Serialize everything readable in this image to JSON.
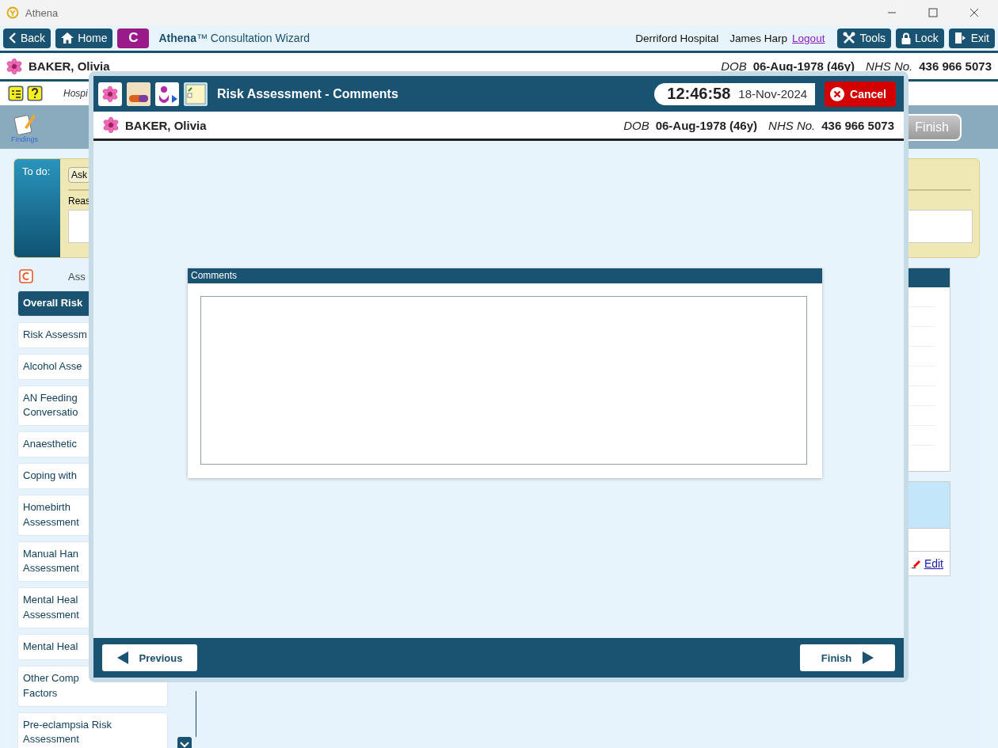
{
  "window": {
    "title": "Athena"
  },
  "nav": {
    "buttons": [
      {
        "label": "Back",
        "kind": "back"
      },
      {
        "label": "Home",
        "kind": "home"
      }
    ],
    "module_badge": "C",
    "app_title": "**Athena**™ Consultation Wizard",
    "location": "Derriford Hospital",
    "user": "James Harp",
    "logout": "Logout",
    "actions": [
      {
        "label": "Tools",
        "kind": "tools"
      },
      {
        "label": "Lock",
        "kind": "lock"
      },
      {
        "label": "Exit",
        "kind": "exit"
      }
    ]
  },
  "patient": {
    "name": "BAKER, Olivia",
    "dob_label": "DOB",
    "dob": "06-Aug-1978 (46y)",
    "nhs_label": "NHS No.",
    "nhs": "436 966 5073"
  },
  "toolbar": {
    "text": "Hospi"
  },
  "steps": {
    "findings_label": "Findings",
    "finish": {
      "label": "Finish",
      "disabled": true
    }
  },
  "todo": {
    "label": "To do:",
    "chip": "Ask",
    "reason_label": "Reas"
  },
  "assessments": {
    "heading": "Ass",
    "items": [
      {
        "lines": [
          "Overall Risk"
        ],
        "selected": true
      },
      {
        "lines": [
          "Risk Assessm"
        ],
        "selected": false
      },
      {
        "lines": [
          "Alcohol Asse"
        ],
        "selected": false
      },
      {
        "lines": [
          "AN Feeding",
          "Conversatio"
        ],
        "selected": false
      },
      {
        "lines": [
          "Anaesthetic"
        ],
        "selected": false
      },
      {
        "lines": [
          "Coping with"
        ],
        "selected": false
      },
      {
        "lines": [
          "Homebirth",
          "Assessment"
        ],
        "selected": false
      },
      {
        "lines": [
          "Manual Han",
          "Assessment"
        ],
        "selected": false
      },
      {
        "lines": [
          "Mental Heal",
          "Assessment"
        ],
        "selected": false
      },
      {
        "lines": [
          "Mental Heal"
        ],
        "selected": false
      },
      {
        "lines": [
          "Other Comp",
          "Factors"
        ],
        "selected": false
      },
      {
        "lines": [
          "Pre-eclampsia Risk",
          "Assessment"
        ],
        "selected": false
      }
    ]
  },
  "edit_link": "Edit",
  "dialog": {
    "title": "Risk Assessment - Comments",
    "time": "12:46:58",
    "date": "18-Nov-2024",
    "cancel": "Cancel",
    "patient": {
      "name": "BAKER, Olivia",
      "dob_label": "DOB",
      "dob": "06-Aug-1978 (46y)",
      "nhs_label": "NHS No.",
      "nhs": "436 966 5073"
    },
    "comments": {
      "label": "Comments"
    },
    "previous": "Previous",
    "finish": "Finish"
  }
}
